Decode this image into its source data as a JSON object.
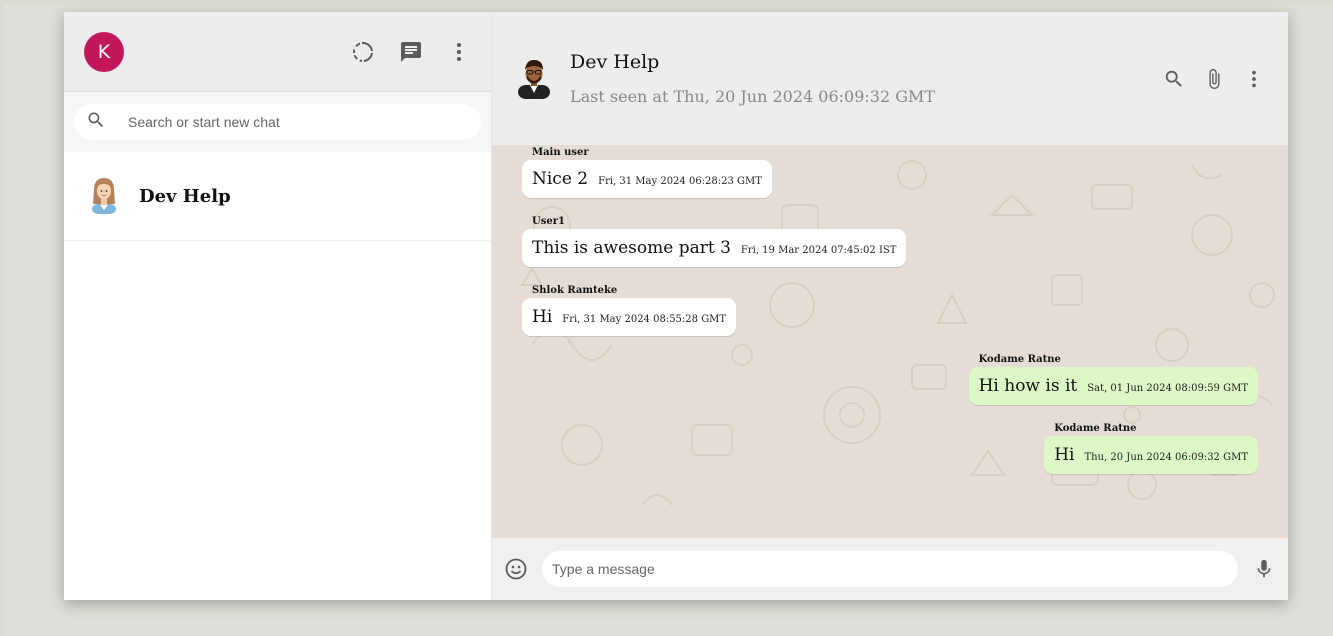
{
  "sidebar": {
    "user_avatar_letter": "K",
    "search_placeholder": "Search or start new chat",
    "chats": [
      {
        "name": "Dev Help"
      }
    ]
  },
  "chat": {
    "title": "Dev Help",
    "last_seen": "Last seen at Thu, 20 Jun 2024 06:09:32 GMT",
    "messages": [
      {
        "author": "Main user",
        "text": "Nice 2",
        "time": "Fri, 31 May 2024 06:28:23 GMT",
        "sent": false
      },
      {
        "author": "User1",
        "text": "This is awesome part 3",
        "time": "Fri, 19 Mar 2024 07:45:02 IST",
        "sent": false
      },
      {
        "author": "Shlok Ramteke",
        "text": "Hi",
        "time": "Fri, 31 May 2024 08:55:28 GMT",
        "sent": false
      },
      {
        "author": "Kodame Ratne",
        "text": "Hi how is it",
        "time": "Sat, 01 Jun 2024 08:09:59 GMT",
        "sent": true
      },
      {
        "author": "Kodame Ratne",
        "text": "Hi",
        "time": "Thu, 20 Jun 2024 06:09:32 GMT",
        "sent": true
      }
    ],
    "input_placeholder": "Type a message"
  },
  "colors": {
    "avatar_bg": "#c2185b",
    "sent_bubble": "#dcf8c6",
    "received_bubble": "#ffffff",
    "chat_bg": "#e5ddd5"
  },
  "icons": [
    "status-icon",
    "new-chat-icon",
    "menu-icon",
    "search-icon",
    "attach-icon",
    "emoji-icon",
    "mic-icon"
  ]
}
